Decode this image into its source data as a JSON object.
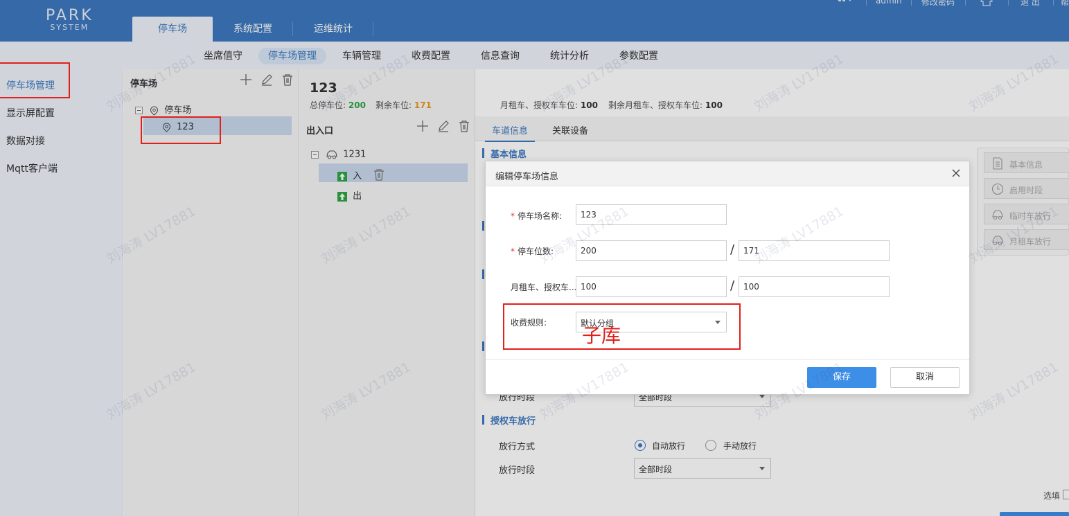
{
  "logo": {
    "line1": "PARK",
    "line2": "SYSTEM"
  },
  "main_tabs": [
    {
      "label": "停车场"
    },
    {
      "label": "系统配置"
    },
    {
      "label": "运维统计"
    }
  ],
  "top_right": {
    "user": "admin",
    "change_password": "修改密码",
    "logout": "退 出",
    "help": "帮"
  },
  "subnav": [
    "坐席值守",
    "停车场管理",
    "车辆管理",
    "收费配置",
    "信息查询",
    "统计分析",
    "参数配置"
  ],
  "sidebar": [
    "停车场管理",
    "显示屏配置",
    "数据对接",
    "Mqtt客户端"
  ],
  "lot_panel": {
    "title": "停车场",
    "root": "停车场",
    "child": "123"
  },
  "gate_panel": {
    "title": "出入口",
    "root": "1231",
    "in": "入",
    "out": "出"
  },
  "lot": {
    "name": "123",
    "total_label": "总停车位:",
    "total": "200",
    "remain_label": "剩余车位:",
    "remain": "171",
    "monthly_label": "月租车、授权车车位:",
    "monthly": "100",
    "monthly_remain_label": "剩余月租车、授权车车位:",
    "monthly_remain": "100"
  },
  "lane_tabs": [
    "车道信息",
    "关联设备"
  ],
  "sections": {
    "basic": "基本信息",
    "auth": "授权车放行",
    "release_time_partial": "放行时段",
    "release_time_value_partial": "全部时段",
    "release_mode": "放行方式",
    "auto": "自动放行",
    "manual": "手动放行",
    "release_time": "放行时段",
    "release_time_value": "全部时段"
  },
  "right_nav": [
    "基本信息",
    "启用时段",
    "临时车放行",
    "月租车放行"
  ],
  "dialog": {
    "title": "编辑停车场信息",
    "name_label": "停车场名称:",
    "name_value": "123",
    "spaces_label": "停车位数:",
    "spaces_total": "200",
    "spaces_remain": "171",
    "monthly_label": "月租车、授权车...",
    "monthly_total": "100",
    "monthly_remain": "100",
    "slash": "/",
    "fee_label": "收费规则:",
    "fee_value": "默认分组",
    "save": "保存",
    "cancel": "取消"
  },
  "annotation": "子库",
  "watermark": "刘海涛 LV17881",
  "bottom_right": "选填",
  "colors": {
    "header": "#3d78bf",
    "accent": "#3d78bf",
    "green": "#2fa444",
    "orange": "#e89a1c",
    "annotation": "#e0201b",
    "primary_button": "#3d8ee6"
  }
}
